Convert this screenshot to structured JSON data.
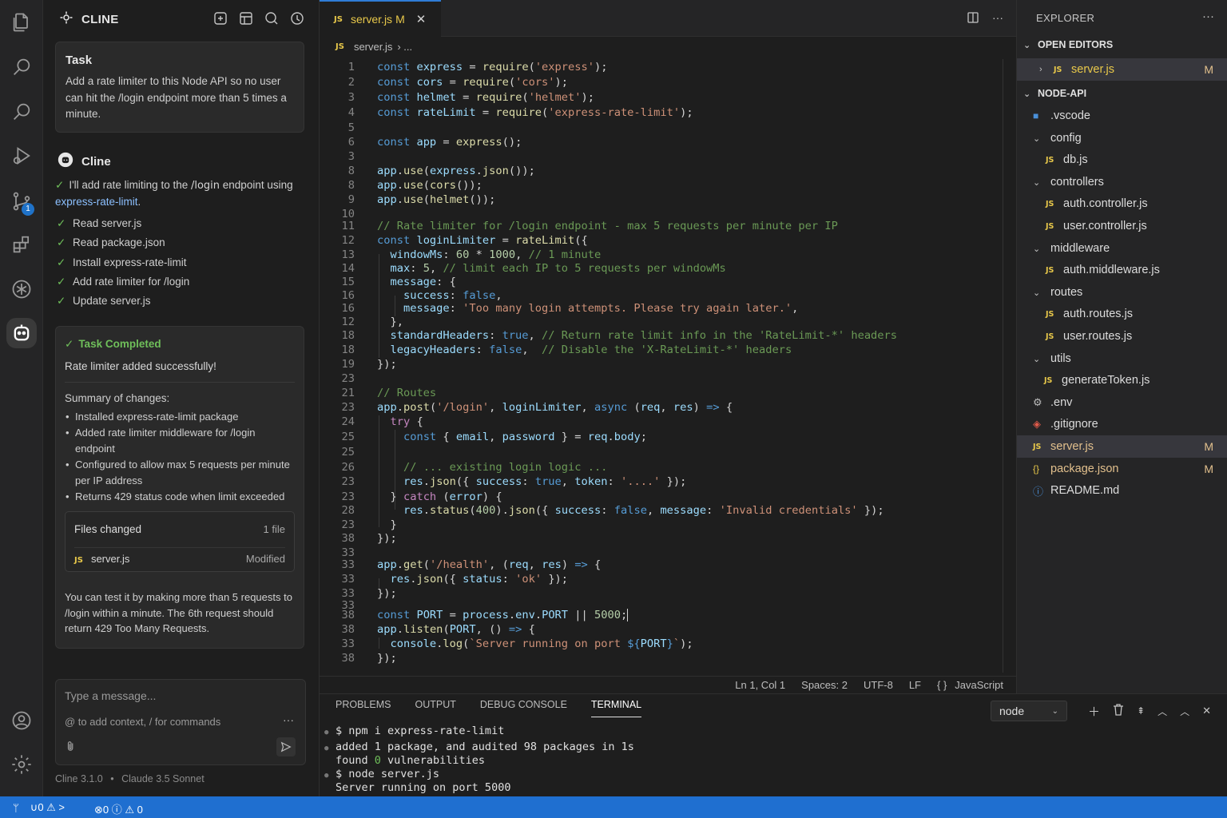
{
  "activity_bar": {
    "items": [
      {
        "icon": "files-icon"
      },
      {
        "icon": "search-icon"
      },
      {
        "icon": "search-icon"
      },
      {
        "icon": "run-debug-icon"
      },
      {
        "icon": "source-control-icon",
        "badge": "1"
      },
      {
        "icon": "extensions-icon"
      },
      {
        "icon": "remote-icon"
      },
      {
        "icon": "cline-icon"
      }
    ],
    "bottom": [
      {
        "icon": "account-icon"
      },
      {
        "icon": "settings-gear-icon"
      }
    ]
  },
  "cline": {
    "title": "CLINE",
    "task": {
      "title": "Task",
      "text": "Add a rate limiter to this Node API so no user can hit the /login endpoint more than 5 times a minute."
    },
    "assistant_name": "Cline",
    "intro": {
      "prefix": "I'll add rate limiting to the ",
      "code": "/login",
      "middle": " endpoint using ",
      "link": "express-rate-limit",
      "suffix": "."
    },
    "steps": [
      "Read server.js",
      "Read package.json",
      "Install express-rate-limit",
      "Add rate limiter for /login",
      "Update server.js"
    ],
    "completion": {
      "title": "Task Completed",
      "subtitle": "Rate limiter added successfully!",
      "summary_heading": "Summary of changes:",
      "summary": [
        "Installed express-rate-limit package",
        "Added rate limiter middleware for /login endpoint",
        "Configured to allow max 5 requests per minute per IP address",
        "Returns 429 status code when limit exceeded"
      ],
      "files_heading": "Files changed",
      "files_count": "1 file",
      "file_badge": "JS",
      "file_name": "server.js",
      "file_status": "Modified",
      "note": "You can test it by making more than 5 requests to /login within a minute. The 6th request should return 429 Too Many Requests."
    },
    "input": {
      "placeholder": "Type a message...",
      "hint": "@ to add context, / for commands",
      "more": "···"
    },
    "footer": {
      "version": "Cline  3.1.0",
      "sep": "•",
      "model": "Claude 3.5 Sonnet"
    }
  },
  "editor": {
    "tab": {
      "badge": "JS",
      "name": "server.js",
      "modified": "M",
      "close": "✕"
    },
    "breadcrumb": {
      "badge": "JS",
      "file": "server.js",
      "rest": "›  ..."
    },
    "line_numbers": [
      "1",
      "2",
      "3",
      "4",
      "5",
      "6",
      "3",
      "8",
      "8",
      "9",
      "10",
      "11",
      "12",
      "13",
      "14",
      "15",
      "16",
      "16",
      "12",
      "18",
      "18",
      "19",
      "23",
      "21",
      "23",
      "24",
      "25",
      "25",
      "26",
      "23",
      "23",
      "28",
      "23",
      "38",
      "33",
      "33",
      "33",
      "33",
      "33",
      "38",
      "38",
      "33",
      "38"
    ],
    "status": {
      "position": "Ln 1, Col 1",
      "spaces": "Spaces: 2",
      "encoding": "UTF-8",
      "eol": "LF",
      "lang_icon": "{ }",
      "language": "JavaScript"
    }
  },
  "panel": {
    "tabs": [
      "PROBLEMS",
      "OUTPUT",
      "DEBUG CONSOLE",
      "TERMINAL"
    ],
    "active_tab": "TERMINAL",
    "shell": "node",
    "terminal": {
      "l1": "$ npm i express-rate-limit",
      "l2": "added 1 package, and audited 98 packages in 1s",
      "l3a": "found ",
      "l3b": "0",
      "l3c": " vulnerabilities",
      "l4": "$ node server.js",
      "l5": "Server running on port 5000"
    }
  },
  "explorer": {
    "title": "EXPLORER",
    "open_editors": "OPEN EDITORS",
    "open_file": {
      "badge": "JS",
      "name": "server.js",
      "status": "M"
    },
    "project": "NODE-API",
    "tree": [
      {
        "name": ".vscode",
        "kind": "folder-blue"
      },
      {
        "name": "config",
        "kind": "folder-open"
      },
      {
        "name": "db.js",
        "kind": "js"
      },
      {
        "name": "controllers",
        "kind": "folder-open"
      },
      {
        "name": "auth.controller.js",
        "kind": "js"
      },
      {
        "name": "user.controller.js",
        "kind": "js"
      },
      {
        "name": "middleware",
        "kind": "folder-open"
      },
      {
        "name": "auth.middleware.js",
        "kind": "js"
      },
      {
        "name": "routes",
        "kind": "folder-open"
      },
      {
        "name": "auth.routes.js",
        "kind": "js"
      },
      {
        "name": "user.routes.js",
        "kind": "js"
      },
      {
        "name": "utils",
        "kind": "folder-open"
      },
      {
        "name": "generateToken.js",
        "kind": "js"
      },
      {
        "name": ".env",
        "kind": "env"
      },
      {
        "name": ".gitignore",
        "kind": "git"
      },
      {
        "name": "server.js",
        "kind": "js",
        "status": "M"
      },
      {
        "name": "package.json",
        "kind": "json",
        "status": "M"
      },
      {
        "name": "README.md",
        "kind": "info"
      }
    ]
  },
  "statusbar": {
    "left_a": "ᛘ",
    "left_b": "∪0 ⚠ >",
    "left_c": "⊗0  ⓘ ⚠ 0"
  }
}
